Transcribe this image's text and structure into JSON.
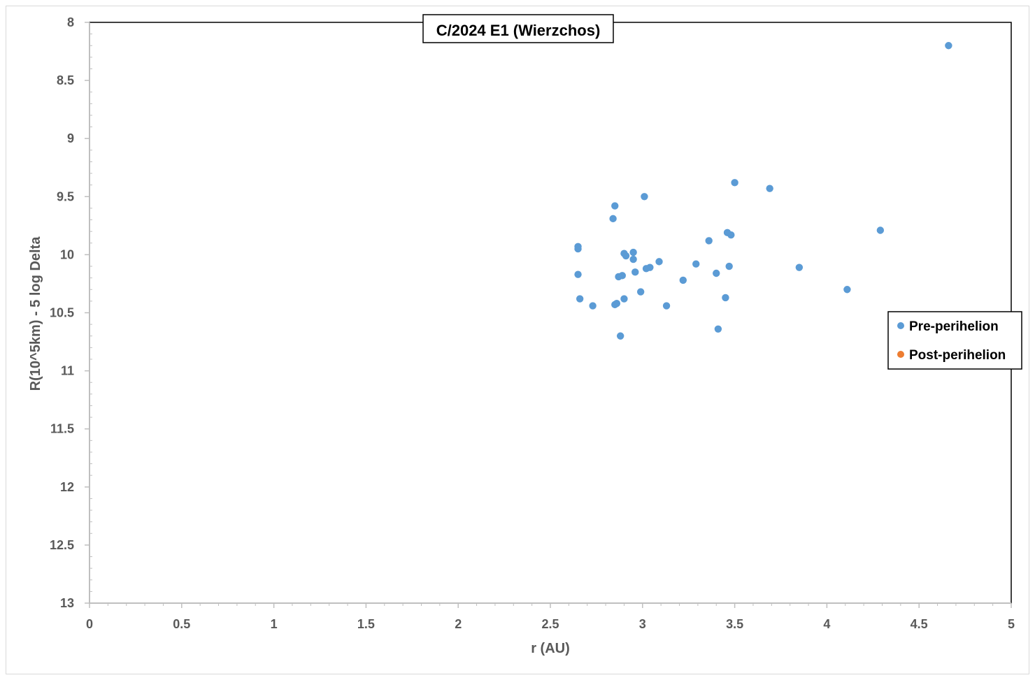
{
  "chart_data": {
    "type": "scatter",
    "title": "C/2024 E1 (Wierzchos)",
    "xlabel": "r (AU)",
    "ylabel": "R(10^5km) - 5 log Delta",
    "xlim": [
      0,
      5
    ],
    "ylim": [
      8,
      13
    ],
    "y_inverted": true,
    "x_ticks": [
      "0",
      "0.5",
      "1",
      "1.5",
      "2",
      "2.5",
      "3",
      "3.5",
      "4",
      "4.5",
      "5"
    ],
    "y_ticks": [
      "8",
      "8.5",
      "9",
      "9.5",
      "10",
      "10.5",
      "11",
      "11.5",
      "12",
      "12.5",
      "13"
    ],
    "grid": false,
    "legend_position": "right",
    "series": [
      {
        "name": "Pre-perihelion",
        "color": "#5b9bd5",
        "points": [
          [
            4.66,
            8.2
          ],
          [
            3.5,
            9.38
          ],
          [
            3.69,
            9.43
          ],
          [
            3.01,
            9.5
          ],
          [
            2.85,
            9.58
          ],
          [
            2.84,
            9.69
          ],
          [
            4.29,
            9.79
          ],
          [
            3.46,
            9.81
          ],
          [
            3.48,
            9.83
          ],
          [
            3.36,
            9.88
          ],
          [
            2.65,
            9.93
          ],
          [
            2.65,
            9.95
          ],
          [
            2.95,
            9.98
          ],
          [
            2.9,
            9.99
          ],
          [
            2.91,
            10.01
          ],
          [
            2.95,
            10.04
          ],
          [
            3.09,
            10.06
          ],
          [
            3.29,
            10.08
          ],
          [
            3.47,
            10.1
          ],
          [
            3.85,
            10.11
          ],
          [
            3.04,
            10.11
          ],
          [
            3.02,
            10.12
          ],
          [
            2.96,
            10.15
          ],
          [
            3.4,
            10.16
          ],
          [
            2.65,
            10.17
          ],
          [
            2.89,
            10.18
          ],
          [
            2.87,
            10.19
          ],
          [
            3.22,
            10.22
          ],
          [
            4.11,
            10.3
          ],
          [
            2.99,
            10.32
          ],
          [
            3.45,
            10.37
          ],
          [
            2.66,
            10.38
          ],
          [
            2.9,
            10.38
          ],
          [
            2.86,
            10.42
          ],
          [
            2.85,
            10.43
          ],
          [
            2.73,
            10.44
          ],
          [
            3.13,
            10.44
          ],
          [
            3.41,
            10.64
          ],
          [
            2.88,
            10.7
          ]
        ]
      },
      {
        "name": "Post-perihelion",
        "color": "#ed7d31",
        "points": []
      }
    ]
  }
}
